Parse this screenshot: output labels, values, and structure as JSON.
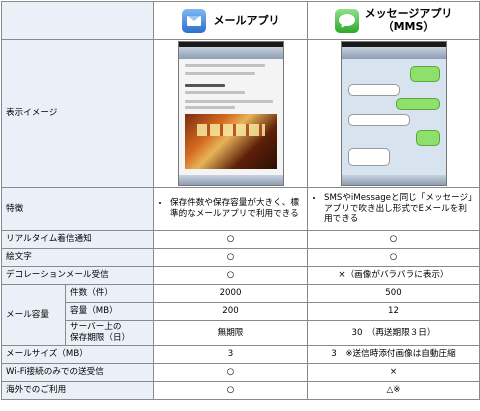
{
  "header": {
    "mail_app": "メールアプリ",
    "message_app_line1": "メッセージアプリ",
    "message_app_line2": "（MMS）"
  },
  "rows": {
    "display_image": "表示イメージ",
    "features": {
      "label": "特徴",
      "mail": "保存件数や保存容量が大きく、標準的なメールアプリで利用できる",
      "message": "SMSやiMessageと同じ「メッセージ」アプリで吹き出し形式でEメールを利用できる"
    },
    "realtime": {
      "label": "リアルタイム着信通知",
      "mail": "○",
      "message": "○"
    },
    "emoji": {
      "label": "絵文字",
      "mail": "○",
      "message": "○"
    },
    "decoration": {
      "label": "デコレーションメール受信",
      "mail": "○",
      "message": "×（画像がバラバラに表示）"
    },
    "capacity": {
      "label": "メール容量",
      "count": {
        "label": "件数（件）",
        "mail": "2000",
        "message": "500"
      },
      "size": {
        "label": "容量（MB）",
        "mail": "200",
        "message": "12"
      },
      "period": {
        "label_line1": "サーバー上の",
        "label_line2": "保存期限（日）",
        "mail": "無期限",
        "message": "30　（再送期限３日）"
      }
    },
    "mail_size": {
      "label": "メールサイズ（MB）",
      "mail": "3",
      "message": "3　※送信時添付画像は自動圧縮"
    },
    "wifi": {
      "label": "Wi-Fi接続のみでの送受信",
      "mail": "○",
      "message": "×"
    },
    "overseas": {
      "label": "海外でのご利用",
      "mail": "○",
      "message": "△※"
    }
  },
  "icons": {
    "mail": "mail-app-icon",
    "message": "messages-app-icon"
  }
}
